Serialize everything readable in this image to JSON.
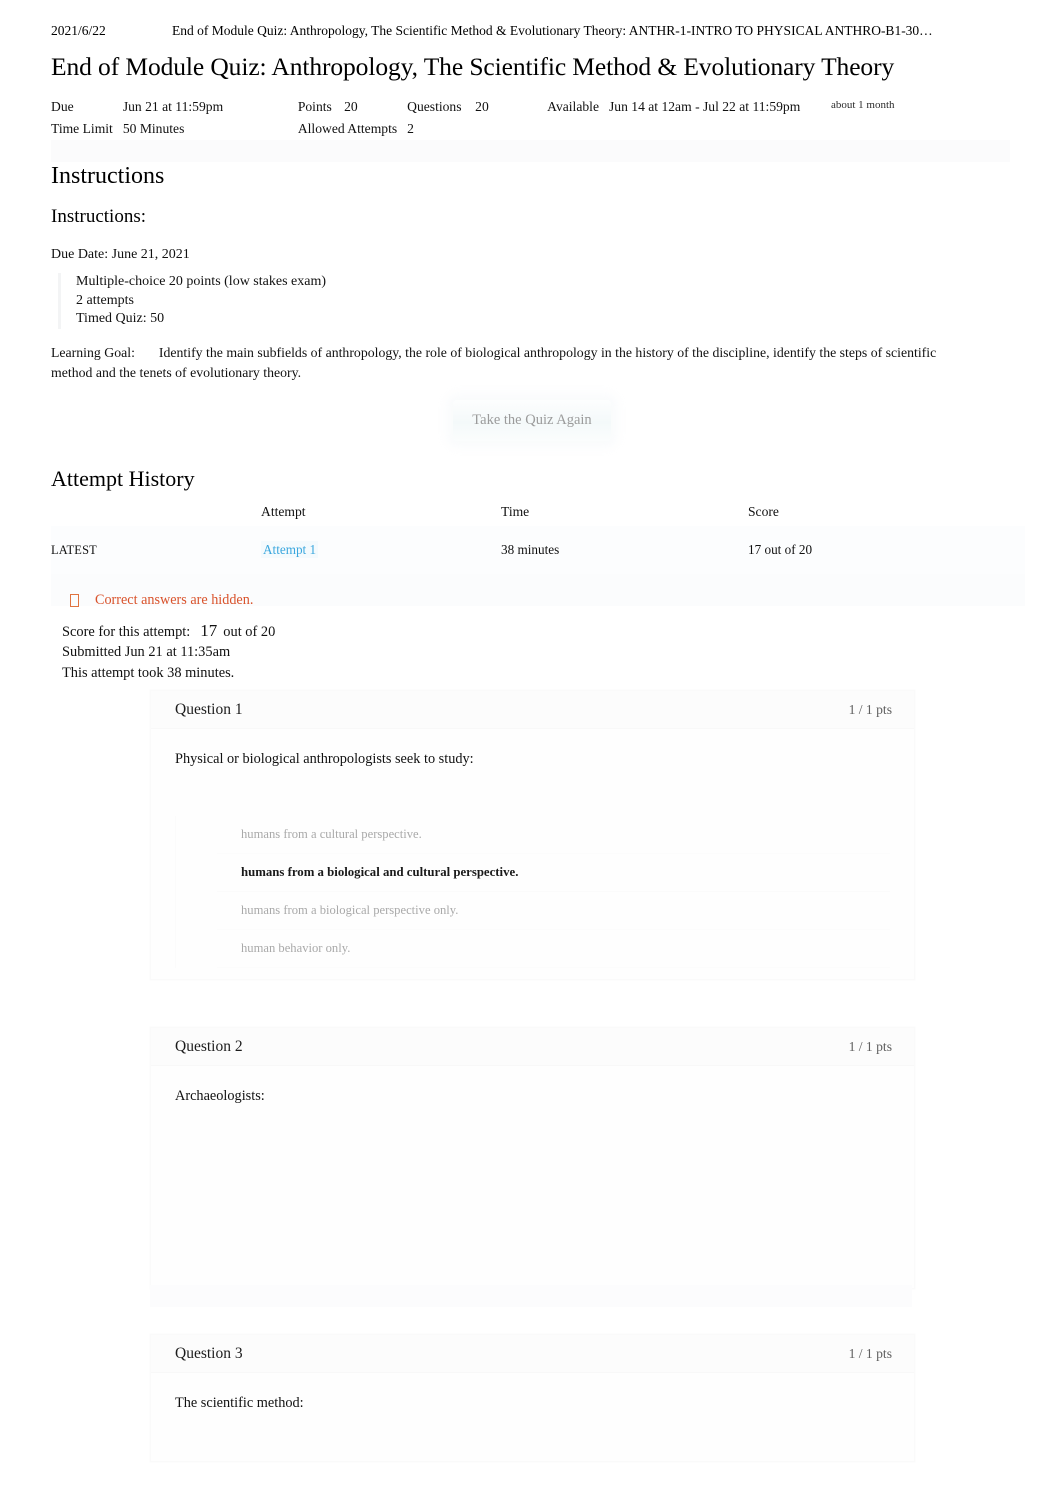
{
  "print_header": {
    "date": "2021/6/22",
    "title": "End of Module Quiz: Anthropology, The Scientific Method & Evolutionary Theory: ANTHR-1-INTRO TO PHYSICAL ANTHRO-B1-30…"
  },
  "page_title": "End of Module Quiz: Anthropology, The Scientific Method & Evolutionary Theory",
  "meta": {
    "due_label": "Due",
    "due_value": "Jun 21 at 11:59pm",
    "points_label": "Points",
    "points_value": "20",
    "questions_label": "Questions",
    "questions_value": "20",
    "available_label": "Available",
    "available_value": "Jun 14 at 12am - Jul 22 at 11:59pm",
    "available_relative": "about 1 month",
    "time_limit_label": "Time Limit",
    "time_limit_value": "50 Minutes",
    "allowed_attempts_label": "Allowed Attempts",
    "allowed_attempts_value": "2"
  },
  "instructions": {
    "heading": "Instructions",
    "subheading": "Instructions:",
    "due_date_line": "Due Date: June 21, 2021",
    "bullets": [
      "Multiple-choice 20 points (low stakes exam)",
      "2 attempts",
      "Timed Quiz: 50"
    ],
    "learning_goal_label": "Learning Goal:",
    "learning_goal_text": "Identify the main subfields of anthropology, the role of biological anthropology in the history of the discipline, identify the steps of scientific method and the tenets of evolutionary theory."
  },
  "retake_button_label": "Take the Quiz Again",
  "attempt_history": {
    "heading": "Attempt History",
    "columns": [
      "",
      "Attempt",
      "Time",
      "Score"
    ],
    "rows": [
      {
        "kept": "LATEST",
        "attempt": "Attempt 1",
        "time": "38 minutes",
        "score": "17 out of 20"
      }
    ]
  },
  "warning": {
    "icon": "warning-icon",
    "text": "Correct answers are hidden.",
    "color": "#d9532c"
  },
  "score_summary": {
    "score_label": "Score for this attempt:",
    "score_value": "17",
    "score_out_of": "out of 20",
    "submitted": "Submitted Jun 21 at 11:35am",
    "duration": "This attempt took 38 minutes."
  },
  "questions": [
    {
      "title": "Question 1",
      "points": "1 / 1 pts",
      "text": "Physical or biological anthropologists seek to study:",
      "answers": [
        {
          "label": "humans from a cultural perspective.",
          "selected": false
        },
        {
          "label": "humans from a biological and cultural perspective.",
          "selected": true
        },
        {
          "label": "humans from a biological perspective only.",
          "selected": false
        },
        {
          "label": "human behavior only.",
          "selected": false
        }
      ]
    },
    {
      "title": "Question 2",
      "points": "1 / 1 pts",
      "text": "Archaeologists:",
      "answers": []
    },
    {
      "title": "Question 3",
      "points": "1 / 1 pts",
      "text": "The scientific method:",
      "answers": []
    }
  ],
  "colors": {
    "link": "#3ba7de",
    "warning": "#d9532c",
    "text": "#111111",
    "muted": "#a9a9a9"
  }
}
